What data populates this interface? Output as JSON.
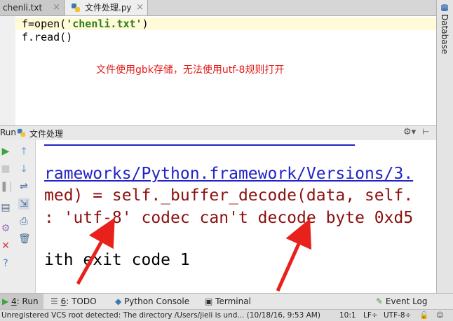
{
  "tabs": [
    {
      "label": "chenli.txt",
      "close": "×"
    },
    {
      "label": "文件处理.py",
      "close": "×"
    }
  ],
  "right_panel": {
    "label": "Database"
  },
  "editor": {
    "lines": [
      {
        "prefix": "f=open(",
        "string": "'chenli.txt'",
        "suffix": ")"
      },
      {
        "prefix": "f.read()",
        "string": "",
        "suffix": ""
      }
    ],
    "annotation": "文件使用gbk存储，无法使用utf-8规则打开",
    "annotation_color": "#e31b1b"
  },
  "run_panel": {
    "label": "Run",
    "config_name": "文件处理",
    "settings_icon": "gear-icon",
    "hide_icon": "hide-icon"
  },
  "console": {
    "lines": [
      {
        "text": "rameworks/Python.framework/Versions/3.",
        "kind": "link"
      },
      {
        "text": "med) = self._buffer_decode(data, self.",
        "kind": "error"
      },
      {
        "text": ": 'utf-8' codec can't decode byte 0xd5",
        "kind": "error"
      },
      {
        "text": "ith exit code 1",
        "kind": "normal"
      }
    ],
    "arrow_color": "#e8211c"
  },
  "bottom_tools": [
    {
      "num": "4",
      "label": ": Run",
      "icon": "run-icon"
    },
    {
      "num": "6",
      "label": ": TODO",
      "icon": "todo-icon"
    },
    {
      "num": "",
      "label": "Python Console",
      "icon": "python-icon"
    },
    {
      "num": "",
      "label": "Terminal",
      "icon": "terminal-icon"
    },
    {
      "num": "",
      "label": "Event Log",
      "icon": "event-log-icon"
    }
  ],
  "status": {
    "message": "Unregistered VCS root detected: The directory /Users/jieli is und... (10/18/16, 9:53 AM)",
    "position": "10:1",
    "line_sep": "LF÷",
    "encoding": "UTF-8÷"
  },
  "colors": {
    "error": "#8c1010",
    "link": "#2222c8",
    "string": "#2e7d1f"
  }
}
